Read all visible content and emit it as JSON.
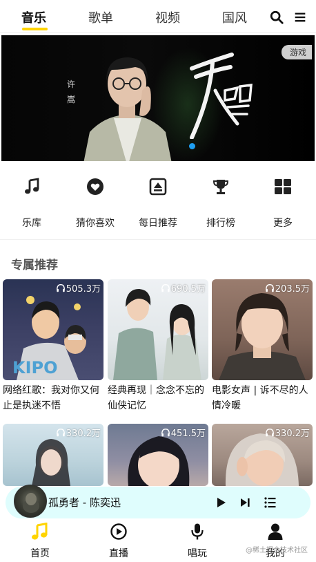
{
  "colors": {
    "accent": "#ffd400",
    "player_bg": "#dffdfd",
    "banner_dot": "#1e9ff2"
  },
  "tabs": [
    {
      "label": "音乐",
      "active": true
    },
    {
      "label": "歌单",
      "active": false
    },
    {
      "label": "视频",
      "active": false
    },
    {
      "label": "国风",
      "active": false
    }
  ],
  "top_icons": [
    "search-icon",
    "menu-icon"
  ],
  "banner": {
    "artist": "许嵩",
    "song_art_text": "天知道",
    "tag": "游戏",
    "active_slide": 1
  },
  "quick_menu": [
    {
      "label": "乐库",
      "icon": "music-note-icon"
    },
    {
      "label": "猜你喜欢",
      "icon": "heart-icon"
    },
    {
      "label": "每日推荐",
      "icon": "daily-recommend-icon"
    },
    {
      "label": "排行榜",
      "icon": "trophy-icon"
    },
    {
      "label": "更多",
      "icon": "grid-icon"
    }
  ],
  "section": {
    "title": "专属推荐",
    "playlists": [
      {
        "plays": "505.3万",
        "title": "网络红歌：我对你又何止是执迷不悟"
      },
      {
        "plays": "690.5万",
        "title": "经典再现｜念念不忘的仙侠记忆"
      },
      {
        "plays": "203.5万",
        "title": "电影女声 | 诉不尽的人情冷暖"
      },
      {
        "plays": "330.2万",
        "title": ""
      },
      {
        "plays": "451.5万",
        "title": ""
      },
      {
        "plays": "330.2万",
        "title": ""
      }
    ]
  },
  "player": {
    "title": "孤勇者 - 陈奕迅",
    "controls": [
      "play-icon",
      "next-icon",
      "playlist-icon"
    ]
  },
  "bottom_nav": [
    {
      "label": "首页",
      "icon": "home-music-icon",
      "active": true
    },
    {
      "label": "直播",
      "icon": "live-play-icon",
      "active": false
    },
    {
      "label": "唱玩",
      "icon": "microphone-icon",
      "active": false
    },
    {
      "label": "我的",
      "icon": "user-icon",
      "active": false
    }
  ],
  "watermark": "@稀土掘金技术社区"
}
